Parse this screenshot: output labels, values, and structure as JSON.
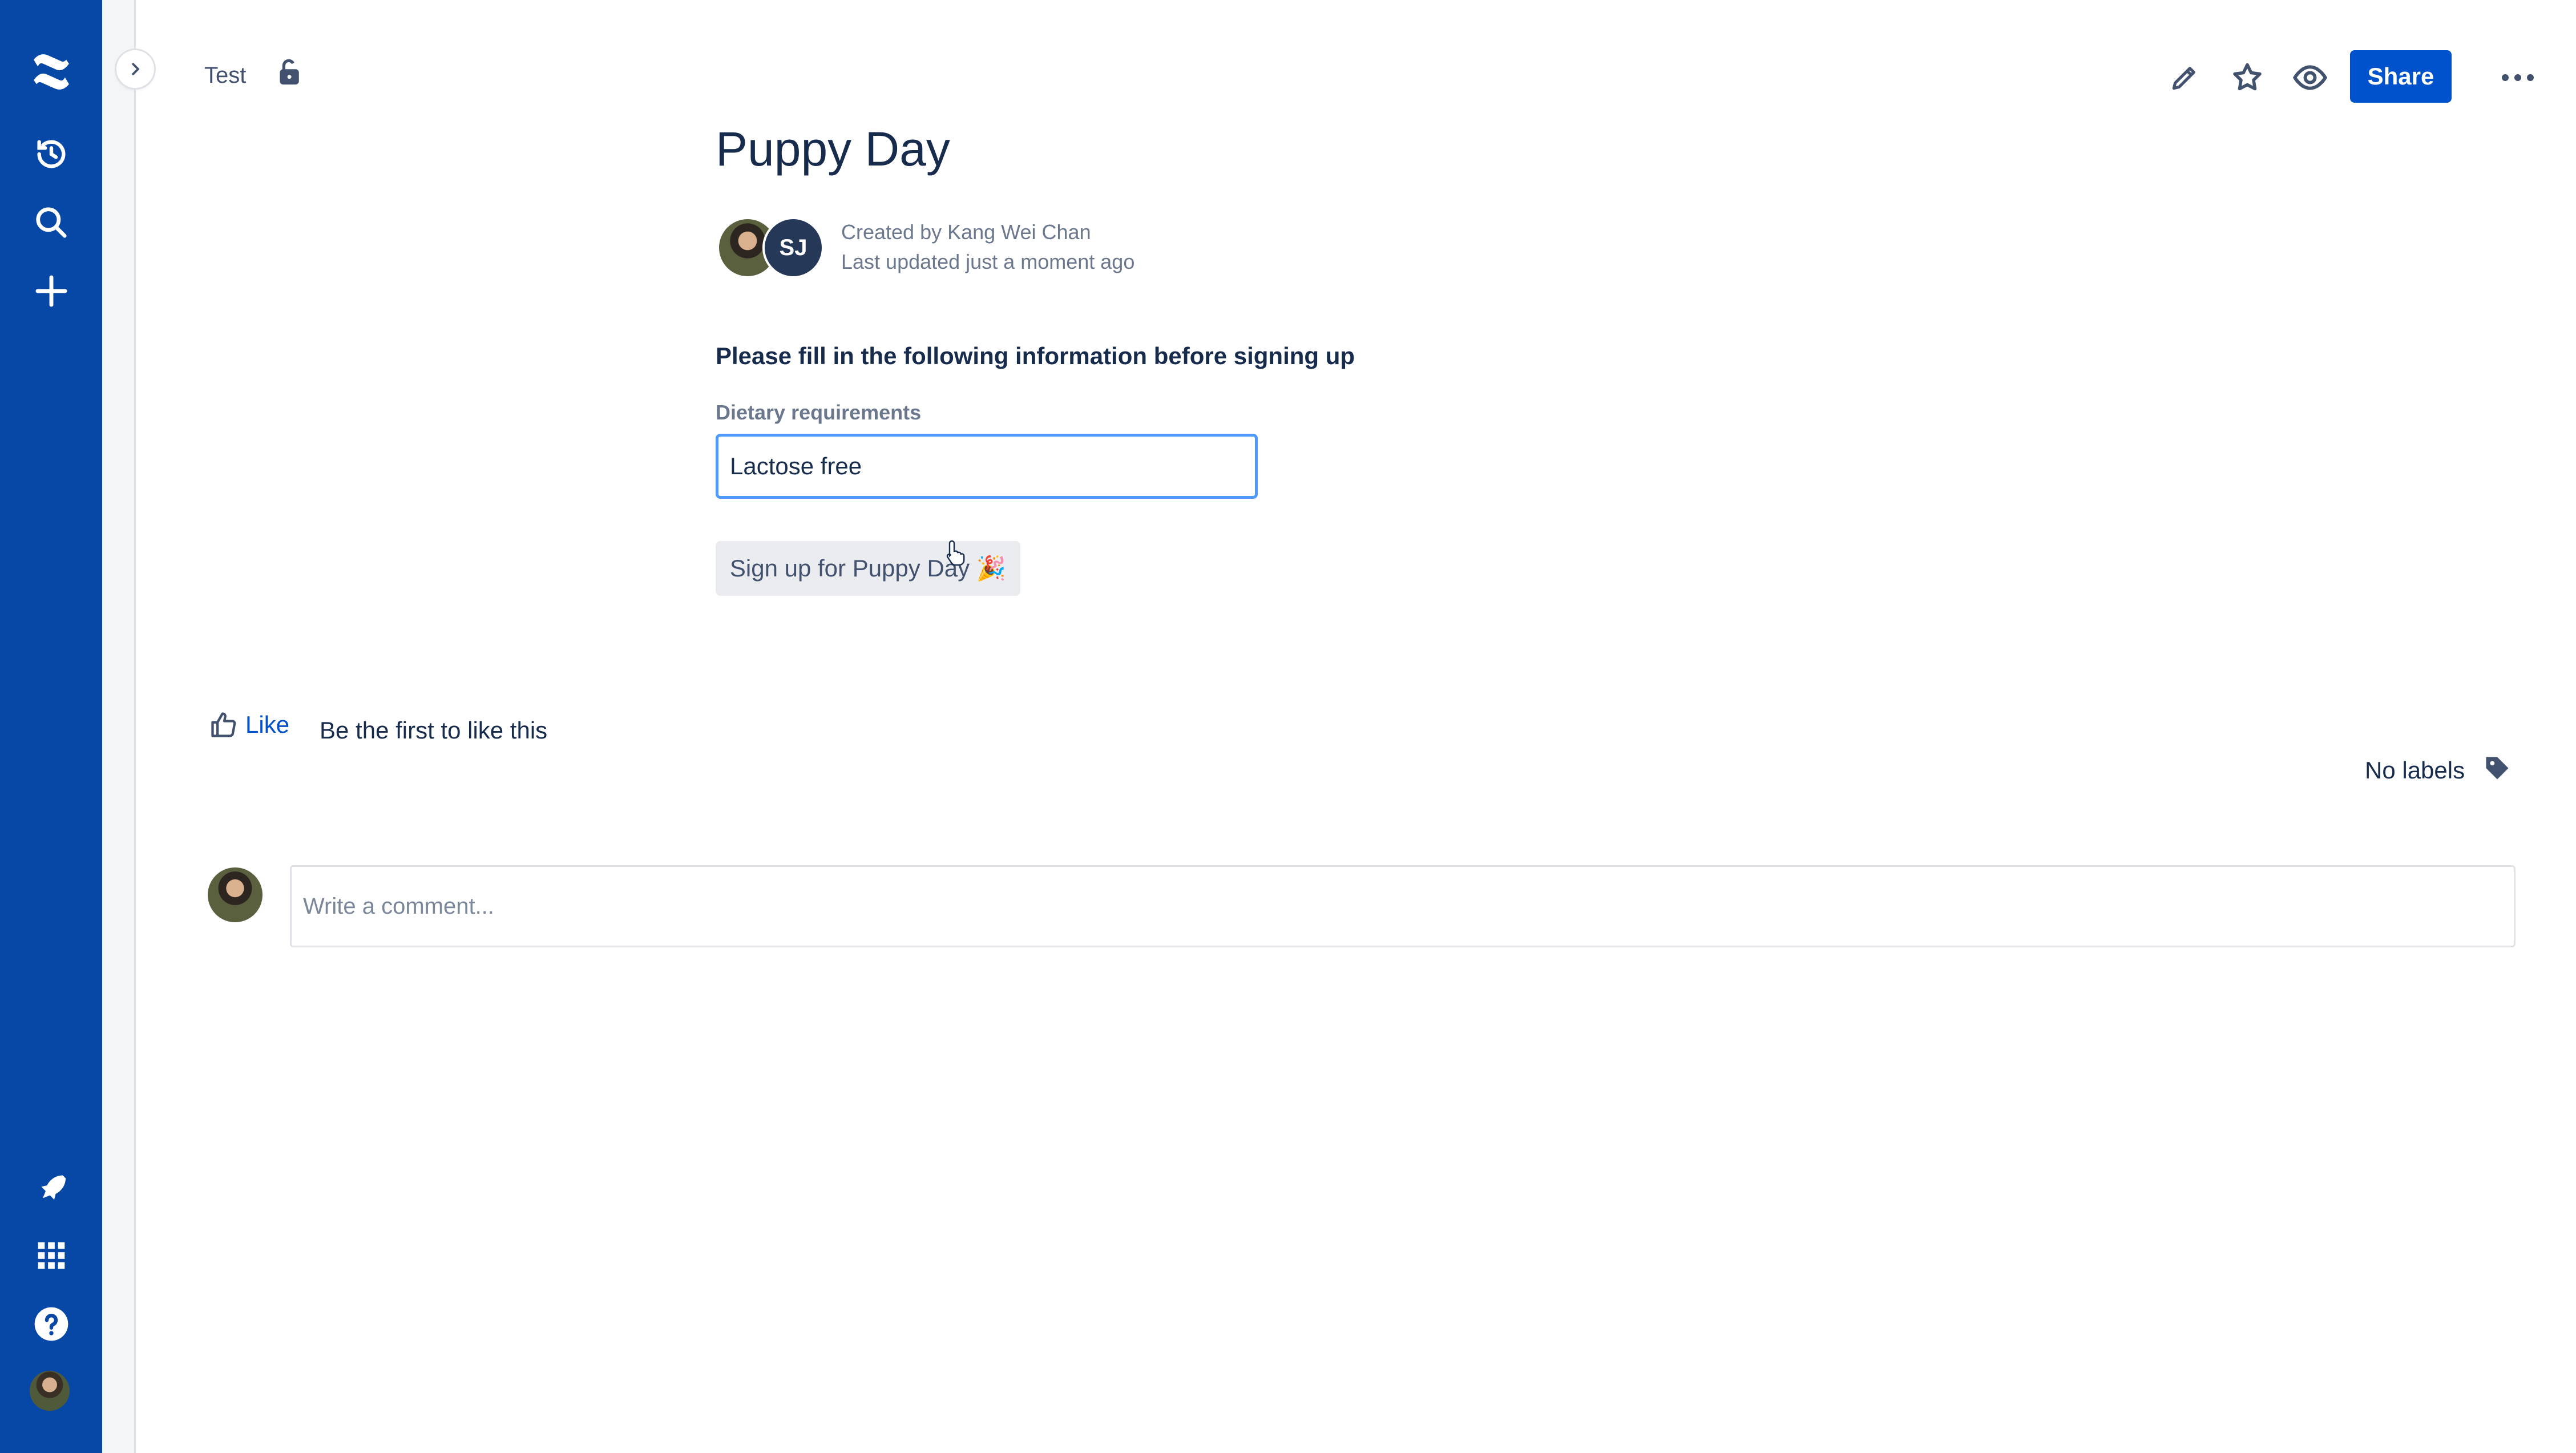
{
  "nav": {
    "items": [
      {
        "icon": "confluence-logo-icon"
      },
      {
        "icon": "recent-icon"
      },
      {
        "icon": "search-icon"
      },
      {
        "icon": "create-icon"
      },
      {
        "icon": "notifications-rocket-icon"
      },
      {
        "icon": "app-switcher-icon"
      },
      {
        "icon": "help-icon"
      },
      {
        "icon": "profile-avatar"
      }
    ],
    "colors": {
      "background": "#0747A6"
    }
  },
  "header": {
    "breadcrumb": "Test",
    "share_label": "Share",
    "actions": [
      "edit-icon",
      "star-icon",
      "watch-icon",
      "more-icon"
    ]
  },
  "page": {
    "title": "Puppy Day",
    "contributor_initials": "SJ",
    "created_by": "Created by Kang Wei Chan",
    "last_updated": "Last updated just a moment ago"
  },
  "form": {
    "heading": "Please fill in the following information before signing up",
    "dietary_label": "Dietary requirements",
    "dietary_value": "Lactose free",
    "submit_label": "Sign up for Puppy Day 🎉"
  },
  "footer": {
    "like_label": "Like",
    "like_text": "Be the first to like this",
    "labels_text": "No labels",
    "comment_placeholder": "Write a comment..."
  },
  "colors": {
    "primary": "#0052CC",
    "text": "#172B4D",
    "focus": "#4C9AFF"
  }
}
